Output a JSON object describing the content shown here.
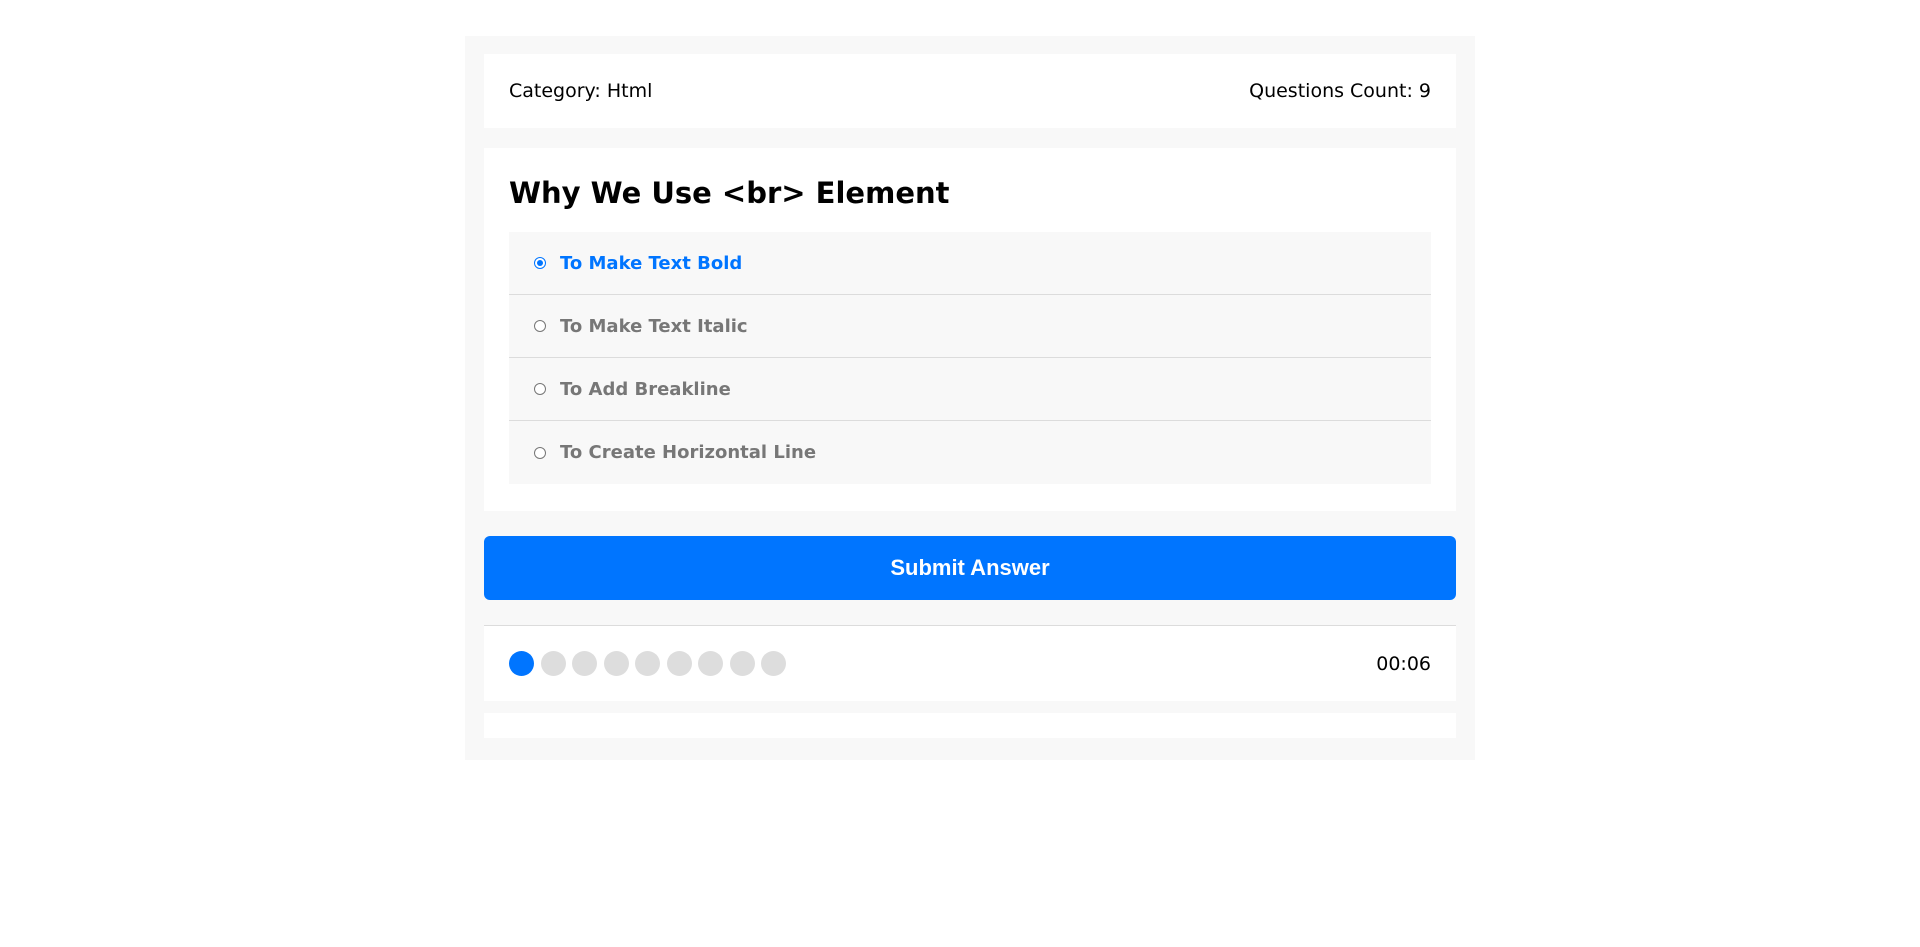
{
  "quiz_info": {
    "category_label": "Category: Html",
    "questions_count_label": "Questions Count: 9"
  },
  "question": {
    "title": "Why We Use <br> Element",
    "answers": [
      {
        "label": "To Make Text Bold",
        "selected": true
      },
      {
        "label": "To Make Text Italic",
        "selected": false
      },
      {
        "label": "To Add Breakline",
        "selected": false
      },
      {
        "label": "To Create Horizontal Line",
        "selected": false
      }
    ]
  },
  "submit": {
    "label": "Submit Answer"
  },
  "progress": {
    "total": 9,
    "current": 1,
    "countdown": "00:06"
  },
  "colors": {
    "accent": "#0075ff",
    "inactive_bullet": "#dddddd",
    "muted_text": "#777777",
    "panel_bg": "#f8f8f8"
  }
}
